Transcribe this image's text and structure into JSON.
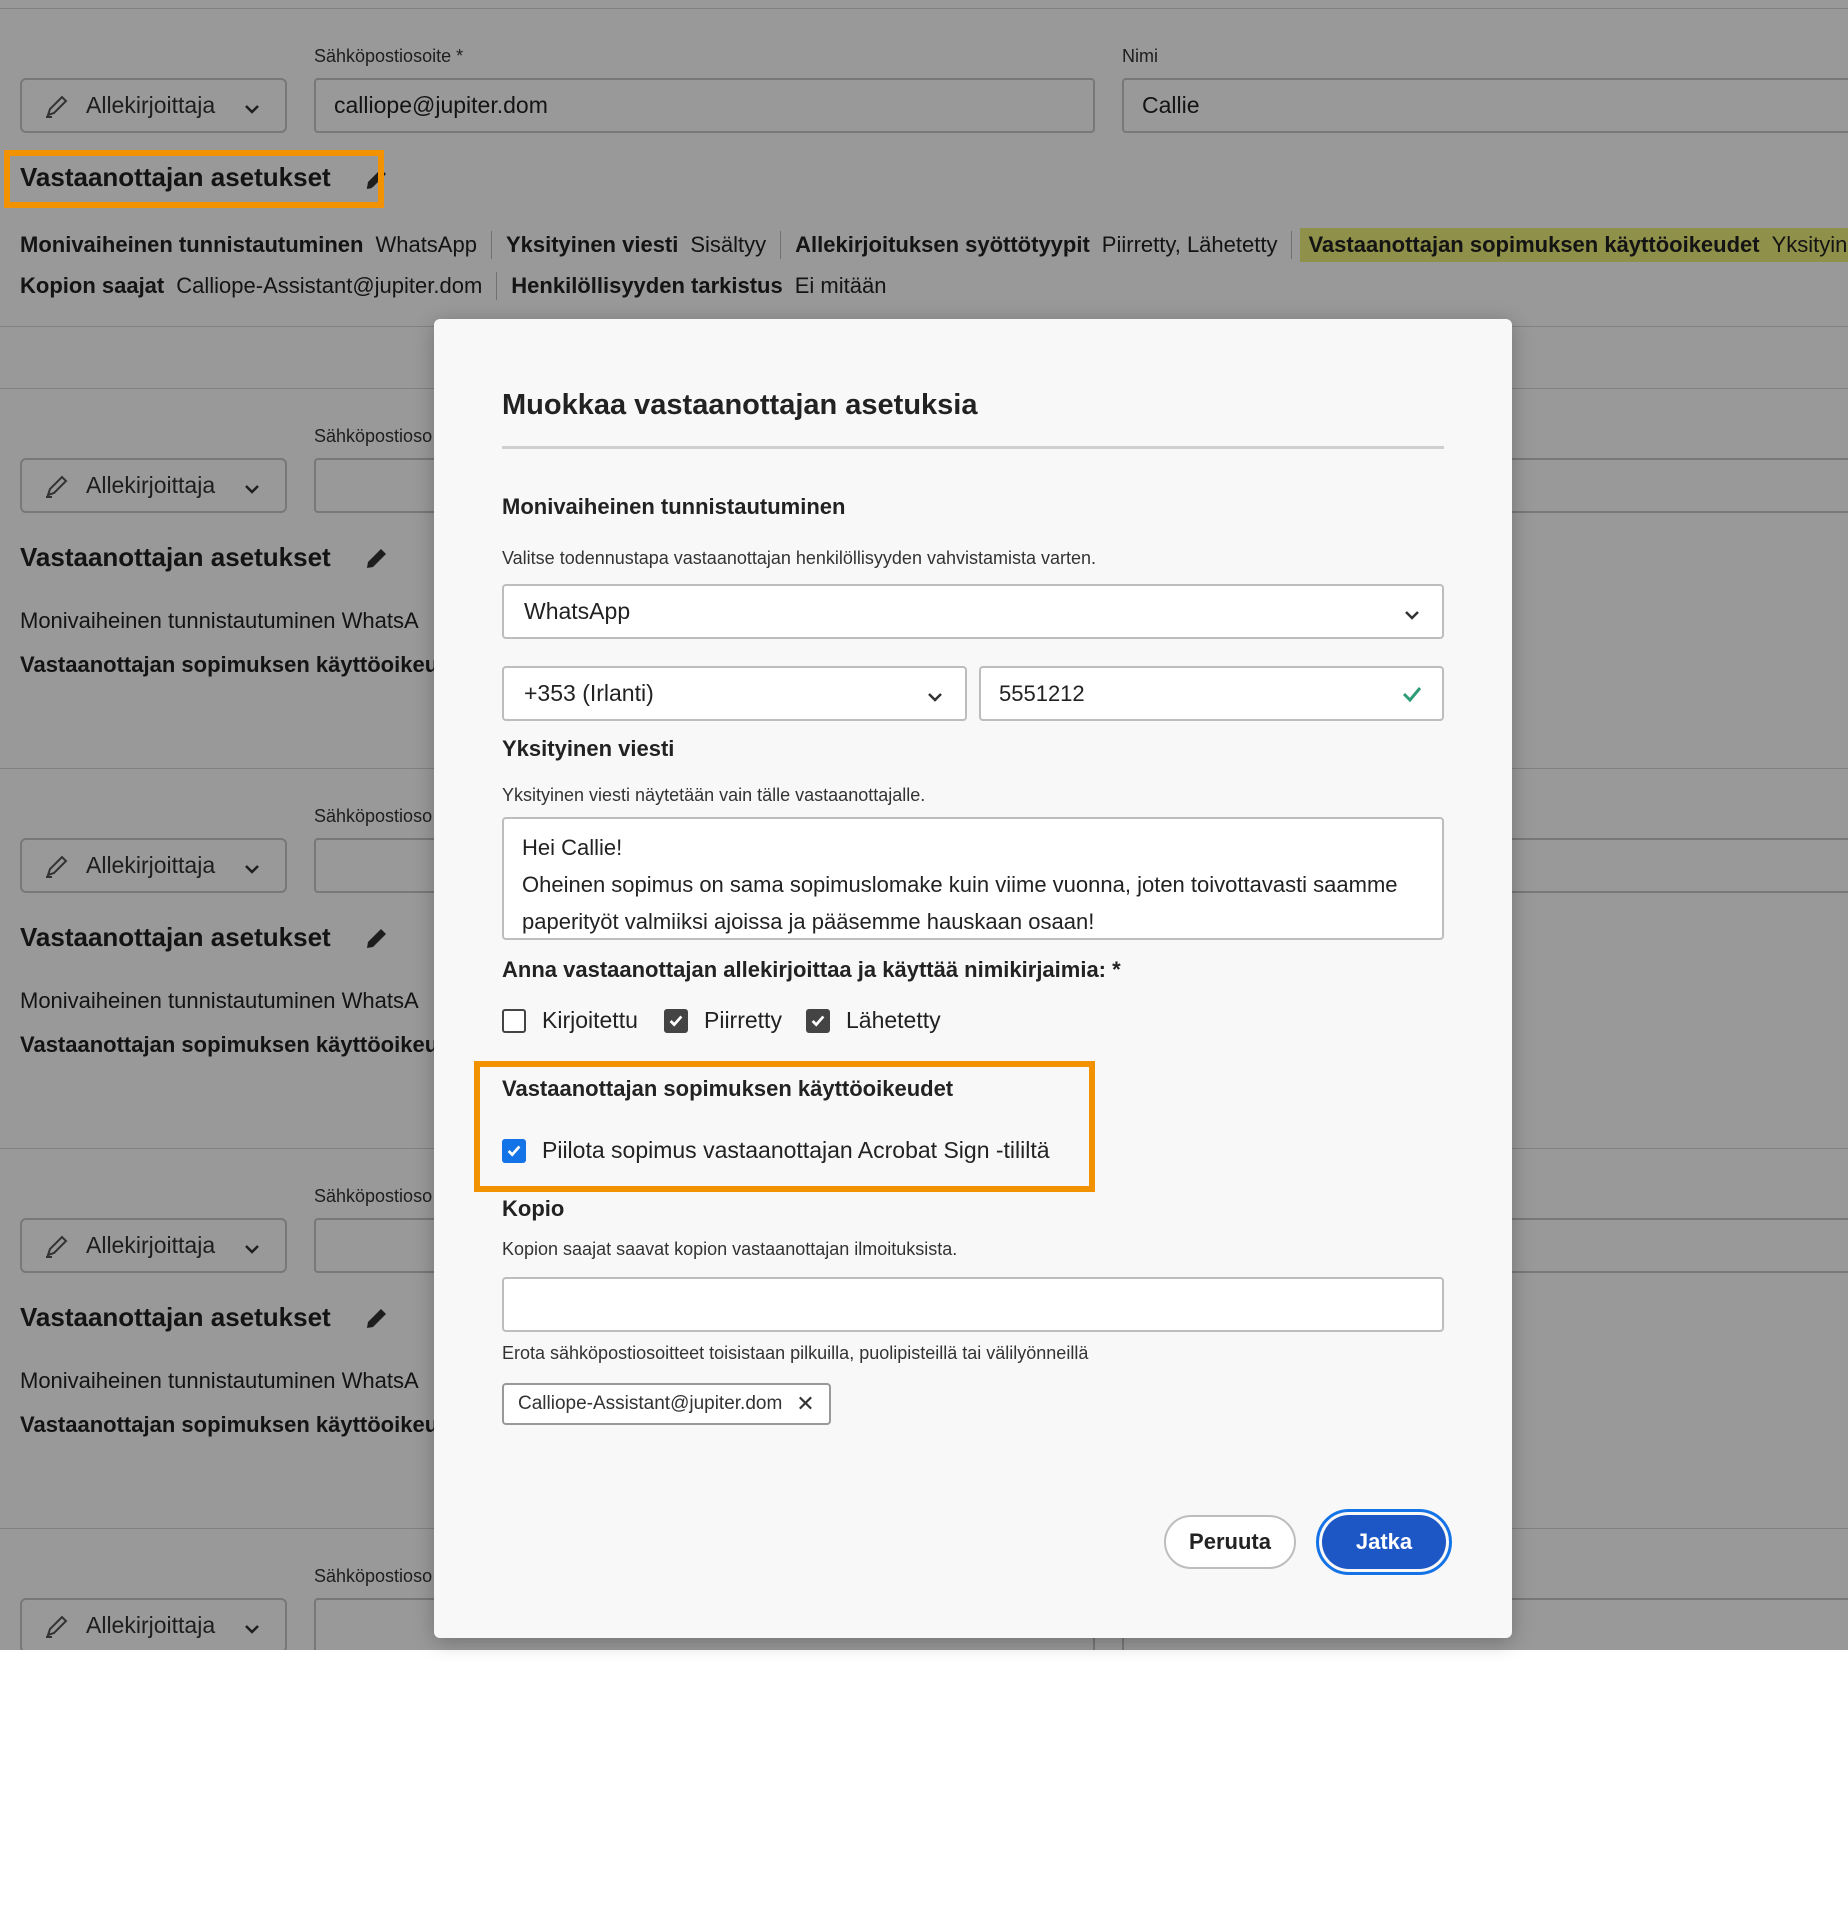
{
  "background": {
    "email_label": "Sähköpostiosoite *",
    "email_label_short": "Sähköpostioso",
    "name_label": "Nimi",
    "role": "Allekirjoittaja",
    "first_recipient": {
      "email": "calliope@jupiter.dom",
      "name": "Callie"
    },
    "settings_title": "Vastaanottajan asetukset",
    "summary_line1": [
      {
        "key": "Monivaiheinen tunnistautuminen",
        "value": "WhatsApp"
      },
      {
        "key": "Yksityinen viesti",
        "value": "Sisältyy"
      },
      {
        "key": "Allekirjoituksen syöttötyypit",
        "value": "Piirretty, Lähetetty"
      },
      {
        "key": "Vastaanottajan sopimuksen käyttöoikeudet",
        "value": "Yksityinen"
      }
    ],
    "summary_line2": [
      {
        "key": "Kopion saajat",
        "value": "Calliope-Assistant@jupiter.dom"
      },
      {
        "key": "Henkilöllisyyden tarkistus",
        "value": "Ei mitään"
      }
    ],
    "truncated_mfa": "Monivaiheinen tunnistautuminen  WhatsA",
    "truncated_access": "Vastaanottajan sopimuksen käyttöoikeud"
  },
  "modal": {
    "title": "Muokkaa vastaanottajan asetuksia",
    "mfa": {
      "heading": "Monivaiheinen tunnistautuminen",
      "help": "Valitse todennustapa vastaanottajan henkilöllisyyden vahvistamista varten.",
      "method": "WhatsApp",
      "country_code": "+353 (Irlanti)",
      "phone": "5551212"
    },
    "private_message": {
      "heading": "Yksityinen viesti",
      "help": "Yksityinen viesti näytetään vain tälle vastaanottajalle.",
      "line1": "Hei Callie!",
      "line2": "Oheinen sopimus on sama sopimuslomake kuin viime vuonna, joten toivottavasti saamme",
      "line3": "paperityöt valmiiksi ajoissa ja pääsemme hauskaan osaan!"
    },
    "signature_types": {
      "heading": "Anna vastaanottajan allekirjoittaa ja käyttää nimikirjaimia: *",
      "options": [
        {
          "label": "Kirjoitettu",
          "checked": false
        },
        {
          "label": "Piirretty",
          "checked": true
        },
        {
          "label": "Lähetetty",
          "checked": true
        }
      ]
    },
    "access": {
      "heading": "Vastaanottajan sopimuksen käyttöoikeudet",
      "option_label": "Piilota sopimus vastaanottajan Acrobat Sign -tililtä",
      "checked": true
    },
    "cc": {
      "heading": "Kopio",
      "help": "Kopion saajat saavat kopion vastaanottajan ilmoituksista.",
      "input_value": "",
      "separator_hint": "Erota sähköpostiosoitteet toisistaan pilkuilla, puolipisteillä tai välilyönneillä",
      "tags": [
        "Calliope-Assistant@jupiter.dom"
      ]
    },
    "cancel_label": "Peruuta",
    "continue_label": "Jatka"
  },
  "colors": {
    "highlight_orange": "#f39200",
    "highlight_yellow": "#eef07a",
    "primary_blue": "#1d56c5",
    "checkbox_blue": "#1473e6",
    "valid_green": "#2d9d78"
  },
  "icons": [
    "pen-icon",
    "chevron-down-icon",
    "pencil-edit-icon",
    "checkmark-icon",
    "close-icon"
  ]
}
